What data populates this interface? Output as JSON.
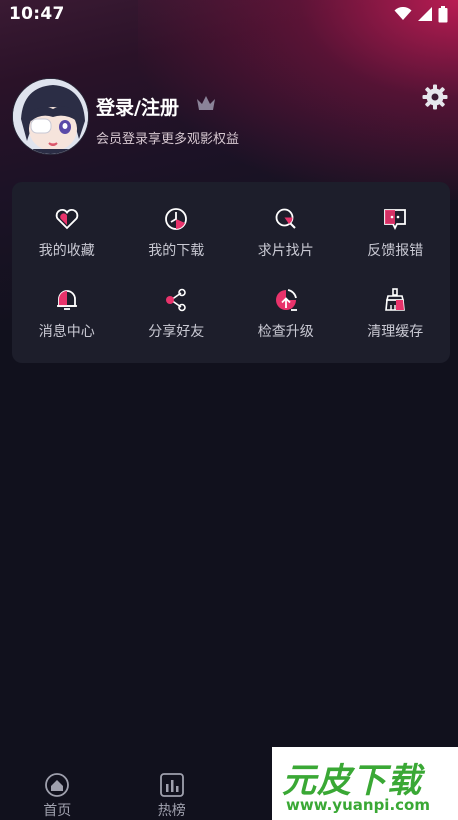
{
  "status_bar": {
    "time": "10:47"
  },
  "profile": {
    "title": "登录/注册",
    "subtitle": "会员登录享更多观影权益"
  },
  "menu": {
    "items": [
      {
        "label": "我的收藏",
        "icon": "heart-icon"
      },
      {
        "label": "我的下载",
        "icon": "download-clock-icon"
      },
      {
        "label": "求片找片",
        "icon": "search-film-icon"
      },
      {
        "label": "反馈报错",
        "icon": "feedback-icon"
      },
      {
        "label": "消息中心",
        "icon": "bell-icon"
      },
      {
        "label": "分享好友",
        "icon": "share-icon"
      },
      {
        "label": "检查升级",
        "icon": "upgrade-icon"
      },
      {
        "label": "清理缓存",
        "icon": "clean-cache-icon"
      }
    ]
  },
  "tabbar": {
    "items": [
      {
        "label": "首页",
        "icon": "home-icon"
      },
      {
        "label": "热榜",
        "icon": "chart-icon"
      }
    ]
  },
  "watermark": {
    "brand": "元皮下载",
    "url": "www.yuanpi.com"
  },
  "colors": {
    "accent": "#e8336b",
    "background": "#11111d",
    "card": "#1d1e2b",
    "watermark_green": "#3aa835"
  }
}
